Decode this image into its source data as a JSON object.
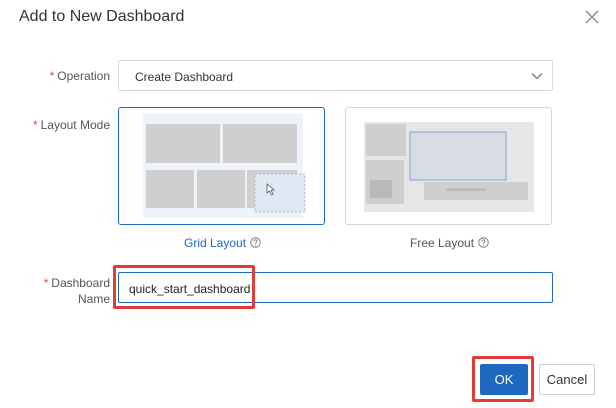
{
  "dialog": {
    "title": "Add to New Dashboard",
    "close_icon": "close-icon"
  },
  "form": {
    "required_mark": "*",
    "operation": {
      "label": "Operation",
      "value": "Create Dashboard",
      "icon": "chevron-down-icon"
    },
    "layout_mode": {
      "label": "Layout Mode",
      "options": [
        {
          "label": "Grid Layout",
          "selected": true,
          "help_icon": "question-circle-icon"
        },
        {
          "label": "Free Layout",
          "selected": false,
          "help_icon": "question-circle-icon"
        }
      ]
    },
    "dashboard_name": {
      "label_line1": "Dashboard",
      "label_line2": "Name",
      "value": "quick_start_dashboard"
    }
  },
  "footer": {
    "ok_label": "OK",
    "cancel_label": "Cancel"
  },
  "colors": {
    "accent": "#1f68c0",
    "required": "#e5483d",
    "highlight": "#e33b3b"
  }
}
